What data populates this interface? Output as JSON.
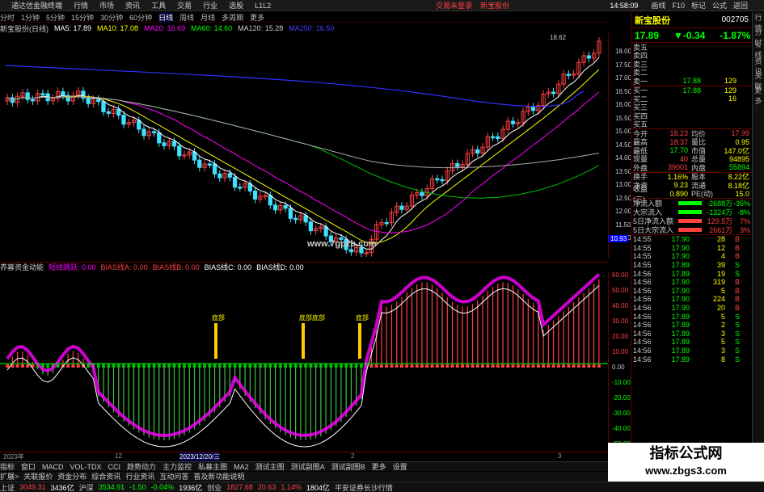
{
  "titlebar": {
    "app_name": "通达信金融终端",
    "menu": [
      "行情",
      "市场",
      "资讯",
      "工具",
      "交易",
      "行业",
      "选股",
      "L1L2"
    ],
    "center": [
      "交易未登录",
      "新宝股份"
    ],
    "right": [
      "画线",
      "F10",
      "标记",
      "公式",
      "返回"
    ],
    "clock": "14:58:09"
  },
  "periodbar": {
    "items": [
      "分时",
      "1分钟",
      "5分钟",
      "15分钟",
      "30分钟",
      "60分钟",
      "日线",
      "周线",
      "月线",
      "多周期",
      "更多"
    ],
    "active": "日线"
  },
  "mabar": {
    "title": "新宝股份(日线)",
    "items": [
      {
        "label": "MA5: 17.89",
        "color": "#ffffff"
      },
      {
        "label": "MA10: 17.08",
        "color": "#ffff00"
      },
      {
        "label": "MA20: 16.69",
        "color": "#ff00ff"
      },
      {
        "label": "MA60: 14.60",
        "color": "#00ff00"
      },
      {
        "label": "MA120: 15.28",
        "color": "#cccccc"
      },
      {
        "label": "MA250: 16.50",
        "color": "#4040ff"
      }
    ]
  },
  "main_axis": [
    "18.00",
    "17.50",
    "17.00",
    "16.50",
    "16.00",
    "15.50",
    "15.00",
    "14.50",
    "14.00",
    "13.50",
    "13.00",
    "12.50",
    "12.00",
    "11.50",
    "11.00",
    "10.93"
  ],
  "high_label": "18.62",
  "low_label": "10.93",
  "watermark_main": "www.7gpzb.com",
  "indbar": {
    "title": "养募资金动能",
    "items": [
      {
        "label": "短线跳跃: 0.00",
        "color": "#ff00ff"
      },
      {
        "label": "BIAS线A: 0.00",
        "color": "#ff4040"
      },
      {
        "label": "BIAS线B: 0.00",
        "color": "#ff4040"
      },
      {
        "label": "BIAS线C: 0.00",
        "color": "#ffffff"
      },
      {
        "label": "BIAS线D: 0.00",
        "color": "#ffffff"
      }
    ]
  },
  "ind_axis": [
    "60.00",
    "50.00",
    "40.00",
    "30.00",
    "20.00",
    "10.00",
    "0.00",
    "-10.00",
    "-20.00",
    "-30.00",
    "-40.00",
    "-50.00"
  ],
  "ind_labels": [
    "底部",
    "底部底部",
    "底部"
  ],
  "datebar": [
    "2023年",
    "12",
    "2023/12/20/三",
    "2",
    "3"
  ],
  "tabbar": [
    "指标",
    "窗口",
    "MACD",
    "VOL-TDX",
    "CCI",
    "趋势动力",
    "主力监控",
    "私募主图",
    "MA2",
    "测试主图",
    "测试副图A",
    "测试副图B",
    "更多",
    "设置"
  ],
  "tabbar2": [
    "扩展>",
    "关联报价",
    "资金分布",
    "综合资讯",
    "行业资讯",
    "互动问答",
    "普及新功能说明"
  ],
  "statusbar": {
    "items": [
      {
        "label": "上证",
        "color": "#cccccc"
      },
      {
        "label": "3049.31",
        "color": "#ff4040"
      },
      {
        "label": "3436亿",
        "color": "#ffffff"
      },
      {
        "label": "沪深",
        "color": "#cccccc"
      },
      {
        "label": "3534.91",
        "color": "#0f0"
      },
      {
        "label": "-1.50",
        "color": "#0f0"
      },
      {
        "label": "-0.04%",
        "color": "#0f0"
      },
      {
        "label": "1936亿",
        "color": "#ffffff"
      },
      {
        "label": "创业",
        "color": "#cccccc"
      },
      {
        "label": "1827.68",
        "color": "#ff4040"
      },
      {
        "label": "20.63",
        "color": "#ff4040"
      },
      {
        "label": "1.14%",
        "color": "#ff4040"
      },
      {
        "label": "1804亿",
        "color": "#ffffff"
      },
      {
        "label": "平安证券长沙行情",
        "color": "#cccccc"
      }
    ]
  },
  "rp": {
    "name": "新宝股份",
    "code": "002705",
    "price": "17.89",
    "change": "▼-0.34",
    "pct": "-1.87%",
    "asks": [
      "卖五",
      "卖四",
      "卖三",
      "卖二",
      "卖一"
    ],
    "ask1": {
      "price": "17.88",
      "vol": "129"
    },
    "bids": [
      {
        "label": "买一",
        "price": "17.88",
        "vol": "129"
      },
      {
        "label": "买二",
        "price": "",
        "vol": "16"
      },
      {
        "label": "买三",
        "price": "",
        "vol": ""
      },
      {
        "label": "买四",
        "price": "",
        "vol": ""
      },
      {
        "label": "买五",
        "price": "",
        "vol": ""
      }
    ],
    "quotes": [
      {
        "k1": "今开",
        "v1": "18.23",
        "c1": "#ff4040",
        "k2": "均价",
        "v2": "17.99",
        "c2": "#ff4040"
      },
      {
        "k1": "最高",
        "v1": "18.37",
        "c1": "#ff4040",
        "k2": "量比",
        "v2": "0.95",
        "c2": "#ff0"
      },
      {
        "k1": "最低",
        "v1": "17.70",
        "c1": "#0f0",
        "k2": "市值",
        "v2": "147.0亿",
        "c2": "#ff0"
      },
      {
        "k1": "现量",
        "v1": "40",
        "c1": "#ff4040",
        "k2": "总量",
        "v2": "94895",
        "c2": "#ff0"
      },
      {
        "k1": "外盘",
        "v1": "39001",
        "c1": "#ff4040",
        "k2": "内盘",
        "v2": "55894",
        "c2": "#0f0"
      }
    ],
    "quotes2": [
      {
        "k1": "换手",
        "v1": "1.16%",
        "c1": "#ff0",
        "k2": "股本",
        "v2": "8.22亿",
        "c2": "#ff0"
      },
      {
        "k1": "净资",
        "v1": "9.23",
        "c1": "#ff0",
        "k2": "流通",
        "v2": "8.18亿",
        "c2": "#ff0"
      },
      {
        "k1": "收益(三)",
        "v1": "0.890",
        "c1": "#ff0",
        "k2": "PE(动)",
        "v2": "15.0",
        "c2": "#ff0"
      }
    ],
    "flows": [
      {
        "k": "净流入额",
        "v": "-2688万",
        "pc": "-35%",
        "color": "#0f0",
        "bar": "#0f0"
      },
      {
        "k": "大宗流入",
        "v": "-1324万",
        "pc": "-8%",
        "color": "#0f0",
        "bar": "#0f0"
      },
      {
        "k": "5日净流入额",
        "v": "129.5万",
        "pc": "7%",
        "color": "#ff4040",
        "bar": "#ff4040"
      },
      {
        "k": "5日大宗流入",
        "v": "2661万",
        "pc": "3%",
        "color": "#ff4040",
        "bar": "#ff4040"
      }
    ],
    "ticks": [
      {
        "t": "14:55",
        "p": "17.90",
        "v": "28",
        "d": "B"
      },
      {
        "t": "14:55",
        "p": "17.90",
        "v": "12",
        "d": "B"
      },
      {
        "t": "14:55",
        "p": "17.90",
        "v": "4",
        "d": "B"
      },
      {
        "t": "14:55",
        "p": "17.89",
        "v": "39",
        "d": "S"
      },
      {
        "t": "14:56",
        "p": "17.89",
        "v": "19",
        "d": "S"
      },
      {
        "t": "14:56",
        "p": "17.90",
        "v": "319",
        "d": "B"
      },
      {
        "t": "14:56",
        "p": "17.90",
        "v": "5",
        "d": "B"
      },
      {
        "t": "14:56",
        "p": "17.90",
        "v": "224",
        "d": "B"
      },
      {
        "t": "14:56",
        "p": "17.90",
        "v": "20",
        "d": "B"
      },
      {
        "t": "14:56",
        "p": "17.89",
        "v": "5",
        "d": "S"
      },
      {
        "t": "14:56",
        "p": "17.89",
        "v": "2",
        "d": "S"
      },
      {
        "t": "14:56",
        "p": "17.89",
        "v": "3",
        "d": "S"
      },
      {
        "t": "14:56",
        "p": "17.89",
        "v": "5",
        "d": "S"
      },
      {
        "t": "14:56",
        "p": "17.89",
        "v": "3",
        "d": "S"
      },
      {
        "t": "14:56",
        "p": "17.89",
        "v": "8",
        "d": "S"
      }
    ]
  },
  "watermark_corner": {
    "line1": "指标公式网",
    "line2": "www.zbgs3.com"
  },
  "sidebar": [
    "行情",
    "分时",
    "K线",
    "资讯",
    "关联",
    "更多"
  ]
}
